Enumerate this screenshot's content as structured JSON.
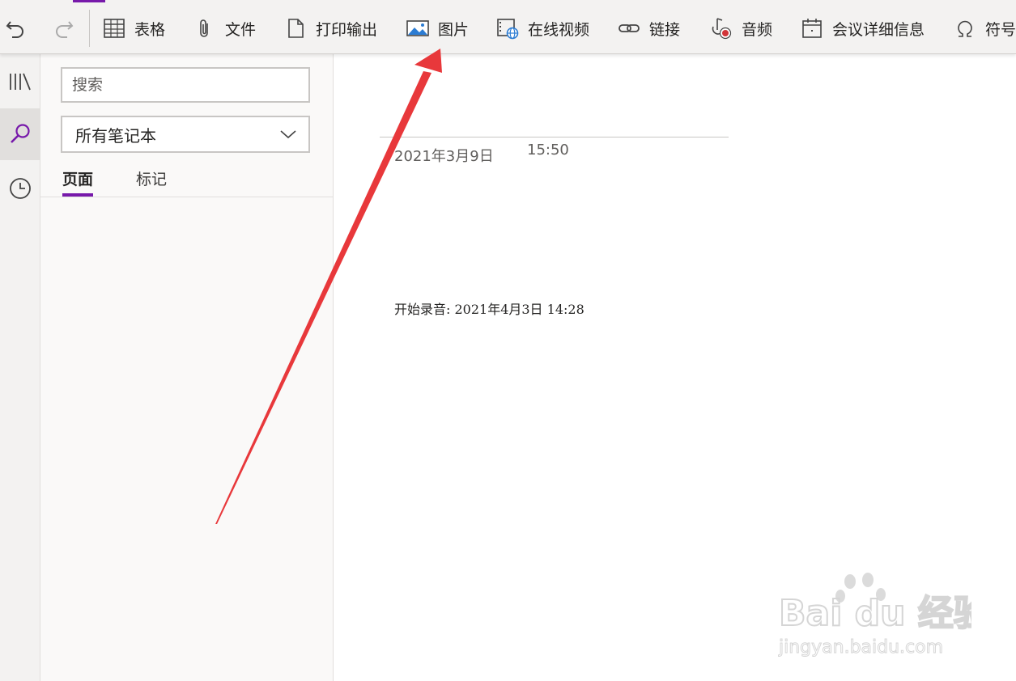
{
  "toolbar": {
    "items": [
      {
        "label": "表格",
        "icon": "table-icon"
      },
      {
        "label": "文件",
        "icon": "paperclip-icon"
      },
      {
        "label": "打印输出",
        "icon": "document-icon"
      },
      {
        "label": "图片",
        "icon": "picture-icon"
      },
      {
        "label": "在线视频",
        "icon": "online-video-icon"
      },
      {
        "label": "链接",
        "icon": "link-icon"
      },
      {
        "label": "音频",
        "icon": "audio-record-icon"
      },
      {
        "label": "会议详细信息",
        "icon": "calendar-icon"
      },
      {
        "label": "符号",
        "icon": "omega-icon"
      }
    ],
    "accent": "#7719aa"
  },
  "search": {
    "placeholder": "搜索",
    "scope": "所有笔记本",
    "tabs": [
      {
        "label": "页面",
        "active": true
      },
      {
        "label": "标记",
        "active": false
      }
    ]
  },
  "page": {
    "date": "2021年3月9日",
    "time": "15:50",
    "recording_note": "开始录音: 2021年4月3日 14:28"
  },
  "watermark": {
    "brand": "Bai du 经验",
    "url": "jingyan.baidu.com"
  },
  "annotation_color": "#e8383b"
}
